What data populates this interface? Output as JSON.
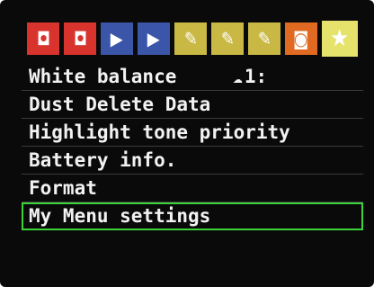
{
  "tabs": [
    {
      "name": "shooting-1",
      "glyph": "◘",
      "color": "#d8342d"
    },
    {
      "name": "shooting-2",
      "glyph": "◘",
      "color": "#d8342d"
    },
    {
      "name": "playback-1",
      "glyph": "▶",
      "color": "#3b56a8"
    },
    {
      "name": "playback-2",
      "glyph": "▶",
      "color": "#3b56a8"
    },
    {
      "name": "setup-1",
      "glyph": "✎",
      "color": "#c9b844"
    },
    {
      "name": "setup-2",
      "glyph": "✎",
      "color": "#c9b844"
    },
    {
      "name": "setup-3",
      "glyph": "✎",
      "color": "#c9b844"
    },
    {
      "name": "custom-functions",
      "glyph": "◙",
      "color": "#e06a22"
    },
    {
      "name": "my-menu",
      "glyph": "★",
      "color": "#e6e36c",
      "selected": true
    }
  ],
  "menu": [
    {
      "label": "White balance",
      "value_icon": "☁",
      "value": "1:"
    },
    {
      "label": "Dust Delete Data"
    },
    {
      "label": "Highlight tone priority"
    },
    {
      "label": "Battery info."
    },
    {
      "label": "Format"
    },
    {
      "label": "My Menu settings",
      "selected": true
    }
  ],
  "colors": {
    "background": "#0a0a0a",
    "selection_border": "#3cd33c",
    "text": "#f2f2f2"
  }
}
